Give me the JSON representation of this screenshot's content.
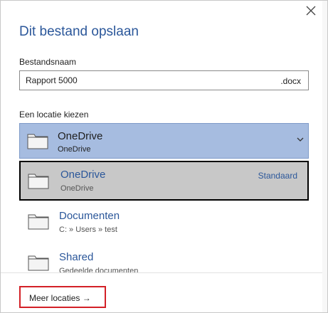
{
  "dialog": {
    "title": "Dit bestand opslaan",
    "close_icon": "close-icon"
  },
  "filename": {
    "label": "Bestandsnaam",
    "value": "Rapport 5000",
    "extension": ".docx"
  },
  "location": {
    "label": "Een locatie kiezen",
    "selected": {
      "name": "OneDrive",
      "sub": "OneDrive",
      "icon": "folder-icon"
    },
    "options": [
      {
        "name": "OneDrive",
        "sub": "OneDrive",
        "badge": "Standaard",
        "selected": true,
        "icon": "folder-icon"
      },
      {
        "name": "Documenten",
        "sub": "C: » Users » test",
        "selected": false,
        "icon": "folder-icon"
      },
      {
        "name": "Shared",
        "sub": "Gedeelde  documenten",
        "selected": false,
        "icon": "folder-icon"
      }
    ]
  },
  "more_locations": {
    "label": "Meer locaties →"
  },
  "colors": {
    "accent": "#2b579a",
    "dropdown_bg": "#a6bce0",
    "selected_option_bg": "#c8c8c8",
    "highlight_border": "#d32027"
  }
}
